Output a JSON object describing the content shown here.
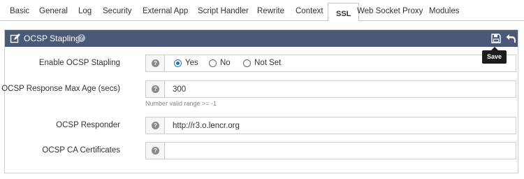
{
  "tabs": [
    {
      "label": "Basic",
      "active": false
    },
    {
      "label": "General",
      "active": false
    },
    {
      "label": "Log",
      "active": false
    },
    {
      "label": "Security",
      "active": false
    },
    {
      "label": "External App",
      "active": false
    },
    {
      "label": "Script Handler",
      "active": false
    },
    {
      "label": "Rewrite",
      "active": false
    },
    {
      "label": "Context",
      "active": false
    },
    {
      "label": "SSL",
      "active": true
    },
    {
      "label": "Web Socket Proxy",
      "active": false
    },
    {
      "label": "Modules",
      "active": false
    }
  ],
  "panel": {
    "title": "OCSP Stapling",
    "edit_icon": "edit-icon",
    "help_icon": "help-icon",
    "save_icon": "save-icon",
    "undo_icon": "undo-icon",
    "save_tooltip": "Save",
    "header_color": "#4b5878"
  },
  "rows": {
    "enable": {
      "label": "Enable OCSP Stapling",
      "options": [
        {
          "label": "Yes",
          "checked": true
        },
        {
          "label": "No",
          "checked": false
        },
        {
          "label": "Not Set",
          "checked": false
        }
      ]
    },
    "max_age": {
      "label": "OCSP Response Max Age (secs)",
      "value": "300",
      "hint": "Number valid range >= -1"
    },
    "responder": {
      "label": "OCSP Responder",
      "value": "http://r3.o.lencr.org"
    },
    "ca_certs": {
      "label": "OCSP CA Certificates",
      "value": ""
    }
  },
  "accent_color": "#1a73c8"
}
